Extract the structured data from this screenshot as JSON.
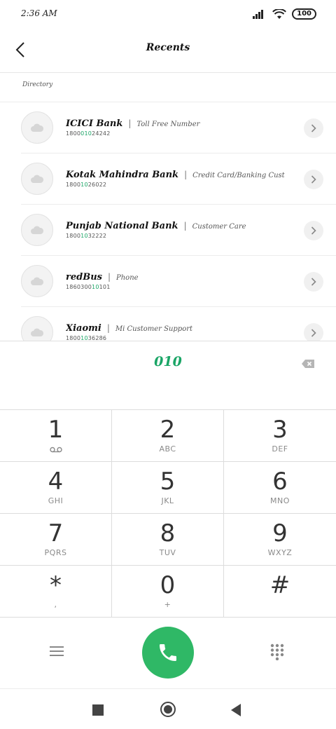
{
  "status_bar": {
    "time": "2:36 AM",
    "battery": "100"
  },
  "header": {
    "title": "Recents"
  },
  "section": {
    "label": "Directory"
  },
  "contacts": [
    {
      "name": "ICICI Bank",
      "type": "Toll Free Number",
      "number_prefix": "1800",
      "number_match": "010",
      "number_suffix": "24242"
    },
    {
      "name": "Kotak Mahindra Bank",
      "type": "Credit Card/Banking Cust",
      "number_prefix": "1800",
      "number_match": "10",
      "number_suffix": "26022"
    },
    {
      "name": "Punjab National Bank",
      "type": "Customer Care",
      "number_prefix": "1800",
      "number_match": "10",
      "number_suffix": "32222"
    },
    {
      "name": "redBus",
      "type": "Phone",
      "number_prefix": "1860300",
      "number_match": "10",
      "number_suffix": "101"
    },
    {
      "name": "Xiaomi",
      "type": "Mi Customer Support",
      "number_prefix": "1800",
      "number_match": "10",
      "number_suffix": "36286"
    }
  ],
  "separator": "|",
  "dial": {
    "value": "010"
  },
  "keypad": [
    {
      "digit": "1",
      "letters": ""
    },
    {
      "digit": "2",
      "letters": "ABC"
    },
    {
      "digit": "3",
      "letters": "DEF"
    },
    {
      "digit": "4",
      "letters": "GHI"
    },
    {
      "digit": "5",
      "letters": "JKL"
    },
    {
      "digit": "6",
      "letters": "MNO"
    },
    {
      "digit": "7",
      "letters": "PQRS"
    },
    {
      "digit": "8",
      "letters": "TUV"
    },
    {
      "digit": "9",
      "letters": "WXYZ"
    },
    {
      "digit": "*",
      "letters": ","
    },
    {
      "digit": "0",
      "letters": "+"
    },
    {
      "digit": "#",
      "letters": ""
    }
  ],
  "icons": {
    "back": "back-arrow-icon",
    "avatar": "cloud-icon",
    "chevron": "chevron-right-icon",
    "backspace": "backspace-icon",
    "voicemail": "voicemail-icon",
    "menu": "menu-icon",
    "call": "phone-icon",
    "dialpad": "dialpad-icon"
  },
  "colors": {
    "accent": "#1aa566",
    "call_button": "#2fb866"
  }
}
